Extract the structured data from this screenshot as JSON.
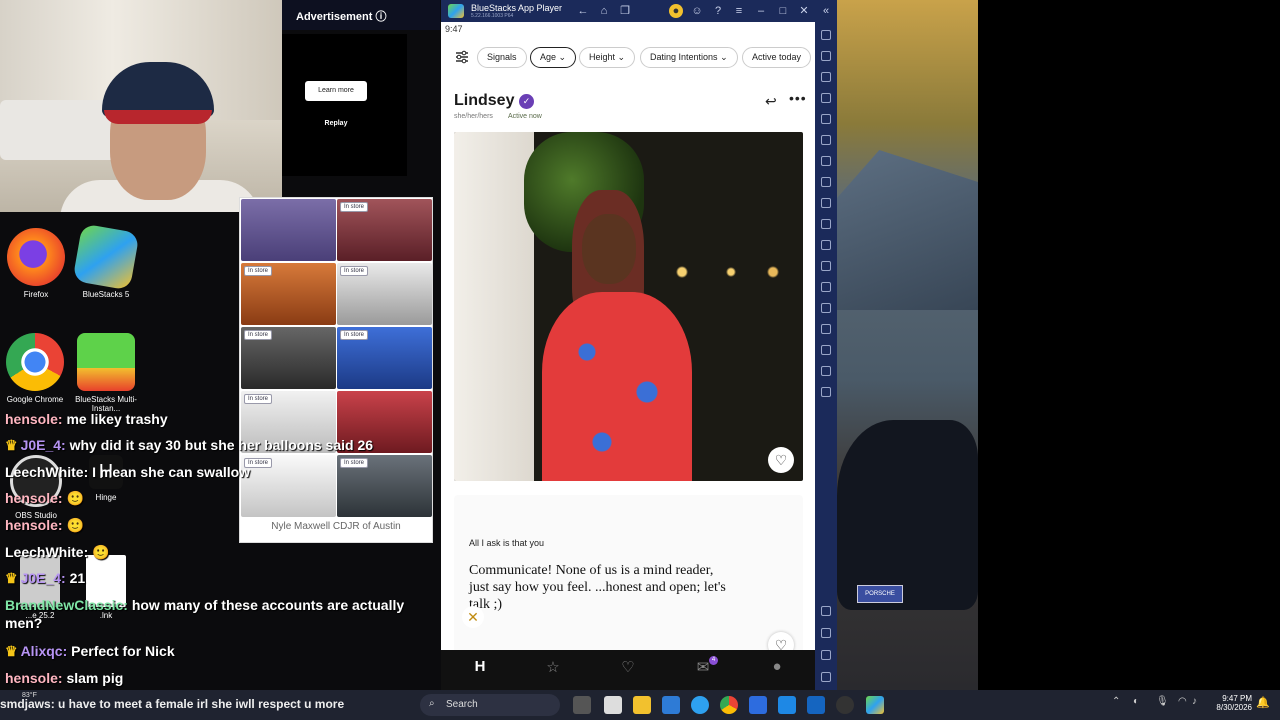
{
  "ad": {
    "header": "Advertisement",
    "learn_more": "Learn more",
    "replay": "Replay",
    "car_tag": "In store",
    "dealer": "Nyle Maxwell CDJR of Austin"
  },
  "desktop_icons": [
    {
      "label": "Firefox"
    },
    {
      "label": "BlueStacks 5"
    },
    {
      "label": "Google Chrome"
    },
    {
      "label": "BlueStacks Multi-Instan..."
    },
    {
      "label": "OBS Studio"
    },
    {
      "label": "Hinge"
    },
    {
      "label": "...e 25.2"
    },
    {
      "label": ".lnk"
    }
  ],
  "chat": [
    {
      "user": "hensole:",
      "msg": "me likey trashy"
    },
    {
      "user": "J0E_4:",
      "msg": "why did it say 30 but she her balloons said 26"
    },
    {
      "user": "LeechWhite:",
      "msg": "I mean she can swallow"
    },
    {
      "user": "hensole:",
      "msg": ""
    },
    {
      "user": "hensole:",
      "msg": ""
    },
    {
      "user": "LeechWhite:",
      "msg": ""
    },
    {
      "user": "J0E_4:",
      "msg": "21"
    },
    {
      "user": "BrandNewClassic:",
      "msg": "how many of these accounts are actually"
    },
    {
      "user": "",
      "msg": "men?"
    },
    {
      "user": "Alixqc:",
      "msg": "Perfect for Nick"
    },
    {
      "user": "hensole:",
      "msg": "slam pig"
    }
  ],
  "scroll_message": "smdjaws: u have to meet a female irl she iwll respect u more",
  "taskbar": {
    "search_placeholder": "Search",
    "weather": "83°F",
    "time": "9:47 PM",
    "date": "8/30/2026"
  },
  "bluestacks": {
    "title": "BlueStacks App Player",
    "subtitle": "5.22.166.1003 P64"
  },
  "app": {
    "status_time": "9:47",
    "filters": [
      "Signals",
      "Age",
      "Height",
      "Dating Intentions",
      "Active today"
    ],
    "profile": {
      "name": "Lindsey",
      "pronouns": "she/her/hers",
      "activity": "Active now"
    },
    "prompt": {
      "question": "All I ask is that you",
      "answer": "Communicate! None of us is a mind reader, just say how you feel. ...honest and open; let's talk ;)"
    },
    "nav_badge": "4"
  },
  "wallpaper_plate": "PORSCHE"
}
